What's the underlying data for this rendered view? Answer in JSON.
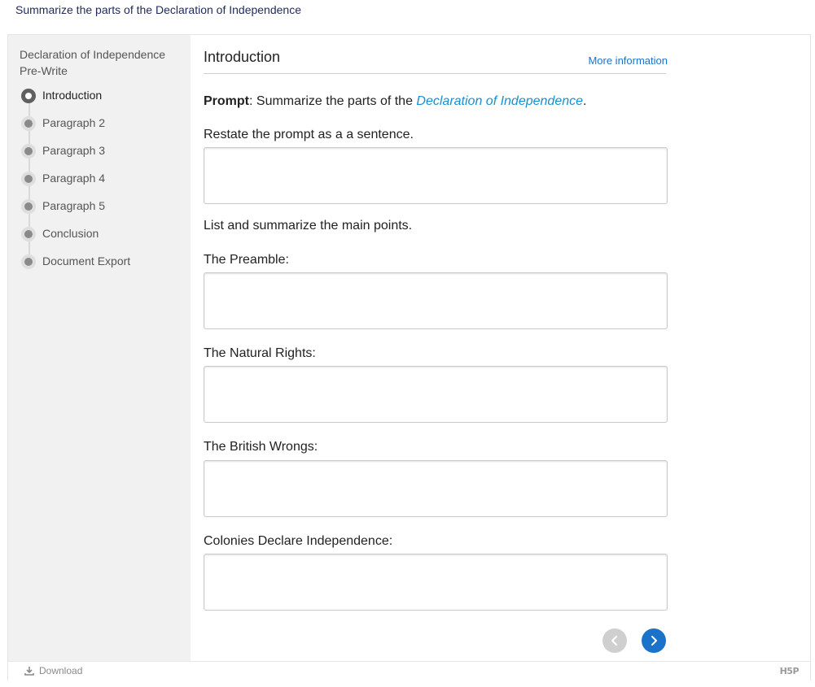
{
  "page": {
    "title": "Summarize the parts of the Declaration of Independence"
  },
  "sidebar": {
    "title": "Declaration of Independence Pre-Write",
    "items": [
      {
        "label": "Introduction",
        "active": true
      },
      {
        "label": "Paragraph 2",
        "active": false
      },
      {
        "label": "Paragraph 3",
        "active": false
      },
      {
        "label": "Paragraph 4",
        "active": false
      },
      {
        "label": "Paragraph 5",
        "active": false
      },
      {
        "label": "Conclusion",
        "active": false
      },
      {
        "label": "Document Export",
        "active": false
      }
    ]
  },
  "main": {
    "heading": "Introduction",
    "more_info": "More information",
    "prompt_label": "Prompt",
    "prompt_text": ": Summarize the parts of the ",
    "prompt_link": "Declaration of Independence",
    "prompt_end": ".",
    "restate_label": "Restate the prompt as a a sentence.",
    "list_label": "List and summarize the main points.",
    "preamble_label": "The Preamble:",
    "natural_rights_label": "The Natural Rights:",
    "british_wrongs_label": "The British Wrongs:",
    "colonies_label": "Colonies Declare Independence:",
    "answers": {
      "restate": "",
      "preamble": "",
      "natural_rights": "",
      "british_wrongs": "",
      "colonies": ""
    }
  },
  "footer": {
    "download_label": "Download",
    "logo_text": "H5P"
  },
  "colors": {
    "accent": "#1a73c8",
    "link": "#1a8fd0",
    "sidebar_bg": "#f1f1f1"
  },
  "icons": {
    "prev": "chevron-left-icon",
    "next": "chevron-right-icon",
    "download": "download-icon"
  }
}
